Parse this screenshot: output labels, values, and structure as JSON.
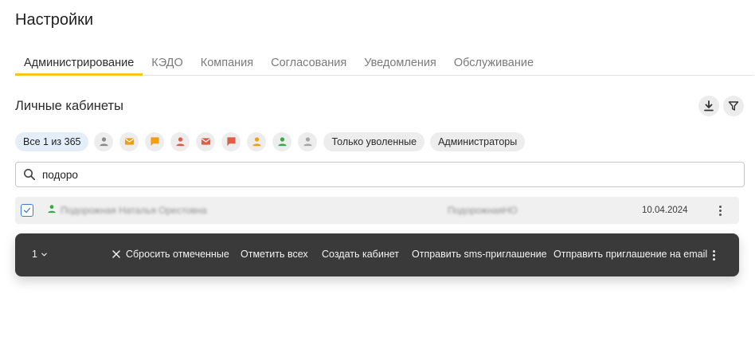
{
  "page": {
    "title": "Настройки"
  },
  "tabs": [
    {
      "label": "Администрирование",
      "active": true
    },
    {
      "label": "КЭДО",
      "active": false
    },
    {
      "label": "Компания",
      "active": false
    },
    {
      "label": "Согласования",
      "active": false
    },
    {
      "label": "Уведомления",
      "active": false
    },
    {
      "label": "Обслуживание",
      "active": false
    }
  ],
  "section": {
    "title": "Личные кабинеты"
  },
  "toolbar": {
    "icons": [
      "download-icon",
      "filter-icon"
    ]
  },
  "filters": {
    "all_label": "Все 1 из 365",
    "status_icons": [
      {
        "icon": "person-icon",
        "color": "#8a8a8a"
      },
      {
        "icon": "envelope-icon",
        "color": "#f39c12"
      },
      {
        "icon": "chat-icon",
        "color": "#f39c12"
      },
      {
        "icon": "person-icon",
        "color": "#e05d44"
      },
      {
        "icon": "envelope-icon",
        "color": "#e05d44"
      },
      {
        "icon": "chat-icon",
        "color": "#e05d44"
      },
      {
        "icon": "person-icon",
        "color": "#f39c12"
      },
      {
        "icon": "person-icon",
        "color": "#3aa845"
      },
      {
        "icon": "person-icon",
        "color": "#a5a5a5"
      }
    ],
    "fired_label": "Только уволенные",
    "admins_label": "Администраторы"
  },
  "search": {
    "value": "подоро",
    "placeholder": ""
  },
  "table": {
    "rows": [
      {
        "checked": true,
        "status_color": "#3aa845",
        "name": "Подорожная Наталья Орестовна",
        "login": "ПодорожнаяНО",
        "date": "10.04.2024"
      }
    ]
  },
  "action_bar": {
    "count": "1",
    "reset_label": "Сбросить отмеченные",
    "select_all_label": "Отметить всех",
    "create_label": "Создать кабинет",
    "sms_label": "Отправить sms-приглашение",
    "email_label": "Отправить приглашение на email"
  },
  "colors": {
    "accent": "#f5c518",
    "checkbox": "#3d7ad6",
    "action_bar_bg": "#3a3a3a",
    "chip_active_bg": "#e3eef9"
  }
}
